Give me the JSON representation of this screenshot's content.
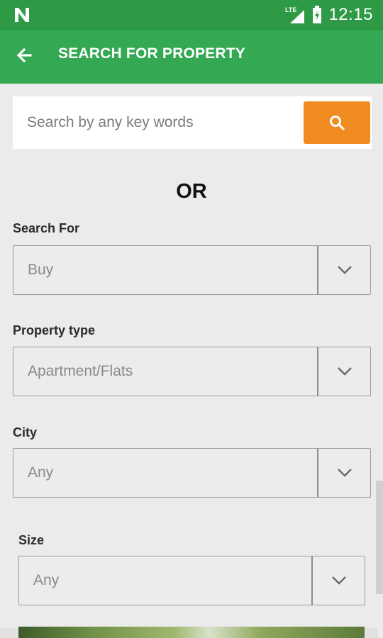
{
  "status_bar": {
    "time": "12:15",
    "network": "LTE"
  },
  "app_bar": {
    "title": "SEARCH FOR PROPERTY"
  },
  "search": {
    "placeholder": "Search by any key words"
  },
  "or_text": "OR",
  "fields": [
    {
      "label": "Search For",
      "value": "Buy"
    },
    {
      "label": "Property type",
      "value": "Apartment/Flats"
    },
    {
      "label": "City",
      "value": "Any"
    },
    {
      "label": "Size",
      "value": "Any"
    }
  ],
  "colors": {
    "status_bar": "#2e9a45",
    "app_bar": "#34a852",
    "search_button": "#f08c1f"
  },
  "icons": {
    "back": "arrow-left-icon",
    "search": "search-icon",
    "dropdown": "chevron-down-icon"
  }
}
